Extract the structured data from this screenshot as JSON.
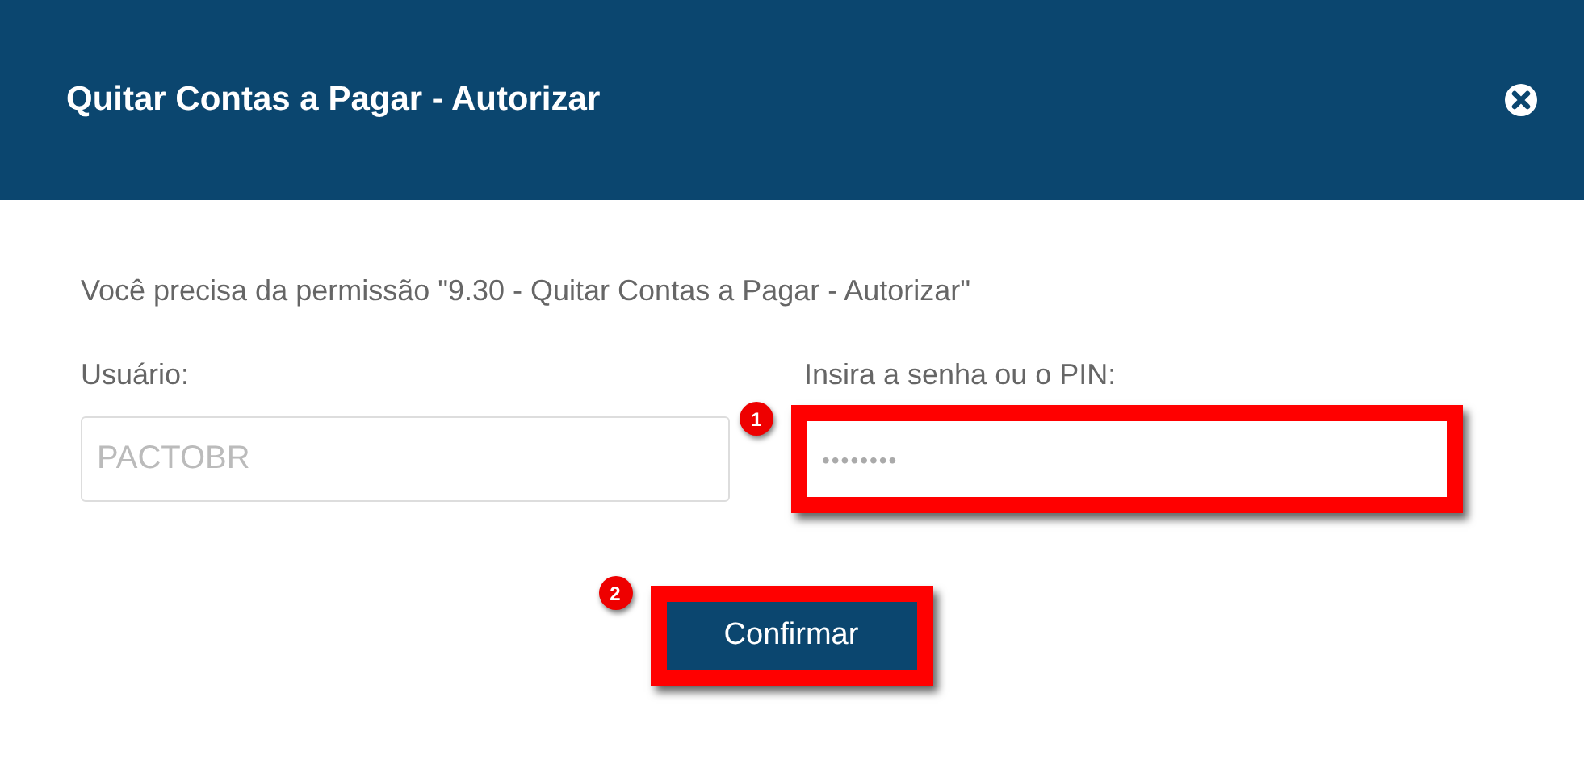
{
  "dialog": {
    "title": "Quitar Contas a Pagar - Autorizar",
    "message": "Você precisa da permissão \"9.30 - Quitar Contas a Pagar - Autorizar\"",
    "fields": [
      {
        "label": "Usuário:",
        "value": "PACTOBR",
        "disabled": true,
        "highlighted": false
      },
      {
        "label": "Insira a senha ou o PIN:",
        "value": "••••••••",
        "disabled": false,
        "highlighted": true,
        "badge": "1"
      }
    ],
    "button": {
      "label": "Confirmar",
      "highlighted": true,
      "badge": "2"
    }
  }
}
